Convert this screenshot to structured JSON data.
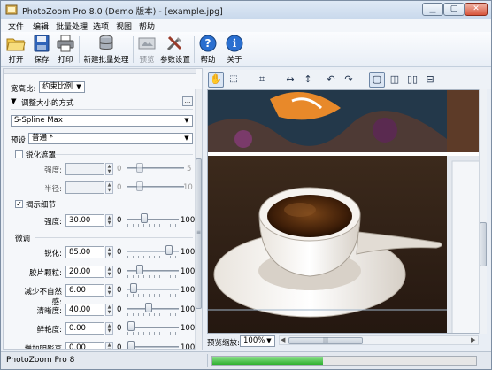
{
  "window": {
    "title": "PhotoZoom Pro 8.0 (Demo 版本) - [example.jpg]",
    "controls": {
      "minimize": "▁",
      "maximize": "▢",
      "close": "✕"
    }
  },
  "menu": [
    "文件",
    "编辑",
    "批量处理",
    "选项",
    "视图",
    "帮助"
  ],
  "toolbar": {
    "open": "打开",
    "save": "保存",
    "print": "打印",
    "new_batch": "新建批量处理",
    "preview": "预览",
    "params": "参数设置",
    "help": "帮助",
    "about": "关于"
  },
  "panel": {
    "aspect_label": "宽高比:",
    "aspect_value": "约束比例",
    "resize_method_label": "调整大小的方式",
    "resize_method_more": "...",
    "method_value": "S-Spline Max",
    "preset_label": "预设:",
    "preset_value": "普通 *",
    "sharpen_mask": {
      "label": "锐化遮罩",
      "checked": false,
      "strength_label": "强度:",
      "strength_value": "",
      "strength_min": "0",
      "strength_max": "5",
      "radius_label": "半径:",
      "radius_value": "",
      "radius_min": "0",
      "radius_max": "10"
    },
    "show_details": {
      "label": "揭示细节",
      "checked": true,
      "strength_label": "强度:",
      "strength_value": "30.00",
      "min": "0",
      "max": "100",
      "level": 0.3
    },
    "fine_tune": {
      "label": "微调",
      "rows": [
        {
          "label": "锐化:",
          "value": "85.00",
          "min": "0",
          "max": "100",
          "level": 0.85
        },
        {
          "label": "胶片颗粒:",
          "value": "20.00",
          "min": "0",
          "max": "100",
          "level": 0.2
        },
        {
          "label": "减少不自然感:",
          "value": "6.00",
          "min": "0",
          "max": "100",
          "level": 0.06
        },
        {
          "label": "清晰度:",
          "value": "40.00",
          "min": "0",
          "max": "100",
          "level": 0.4
        },
        {
          "label": "鲜艳度:",
          "value": "0.00",
          "min": "0",
          "max": "100",
          "level": 0
        },
        {
          "label": "增加阴影亮度:",
          "value": "0.00",
          "min": "0",
          "max": "100",
          "level": 0
        }
      ]
    }
  },
  "view": {
    "zoom_label": "预览缩放:",
    "zoom_value": "100%",
    "scroll_grip": "|||"
  },
  "status": {
    "text": "PhotoZoom Pro 8",
    "progress": 0.42
  },
  "colors": {
    "progress": "#3cc43c",
    "accent": "#1f5fb0"
  }
}
